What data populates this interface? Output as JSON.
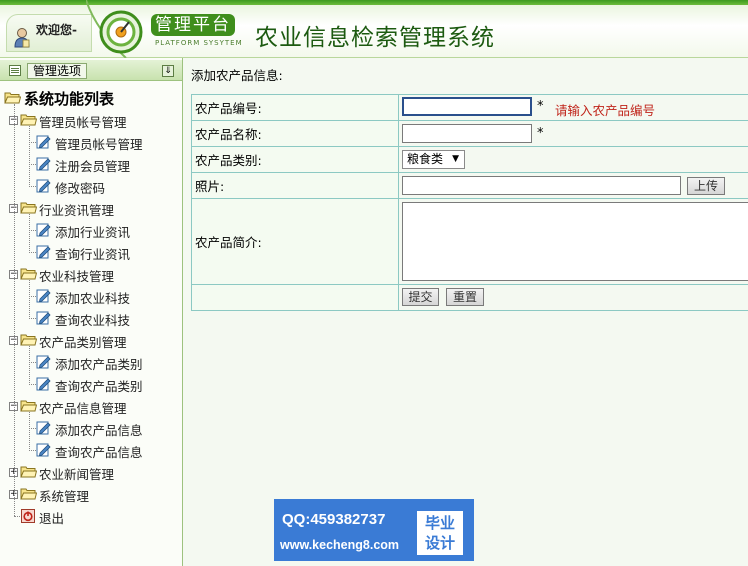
{
  "header": {
    "welcome": "欢迎您-",
    "platform_cn": "管理平台",
    "platform_en": "PLATFORM SYSYTEM",
    "system_title": "农业信息检索管理系统"
  },
  "sidebar": {
    "head_button": "管理选项",
    "root_label": "系统功能列表",
    "groups": [
      {
        "label": "管理员帐号管理",
        "expanded": true,
        "items": [
          "管理员帐号管理",
          "注册会员管理",
          "修改密码"
        ]
      },
      {
        "label": "行业资讯管理",
        "expanded": true,
        "items": [
          "添加行业资讯",
          "查询行业资讯"
        ]
      },
      {
        "label": "农业科技管理",
        "expanded": true,
        "items": [
          "添加农业科技",
          "查询农业科技"
        ]
      },
      {
        "label": "农产品类别管理",
        "expanded": true,
        "items": [
          "添加农产品类别",
          "查询农产品类别"
        ]
      },
      {
        "label": "农产品信息管理",
        "expanded": true,
        "items": [
          "添加农产品信息",
          "查询农产品信息"
        ]
      },
      {
        "label": "农业新闻管理",
        "expanded": false,
        "items": []
      },
      {
        "label": "系统管理",
        "expanded": false,
        "items": []
      }
    ],
    "logout": "退出"
  },
  "form": {
    "caption": "添加农产品信息:",
    "fields": {
      "code_label": "农产品编号:",
      "code_value": "",
      "code_required": "*",
      "code_hint": "请输入农产品编号",
      "name_label": "农产品名称:",
      "name_value": "",
      "name_required": "*",
      "category_label": "农产品类别:",
      "category_selected": "粮食类",
      "photo_label": "照片:",
      "photo_value": "",
      "upload_button": "上传",
      "intro_label": "农产品简介:",
      "intro_value": ""
    },
    "submit_button": "提交",
    "reset_button": "重置"
  },
  "watermark": {
    "qq": "QQ:459382737",
    "url": "www.kecheng8.com",
    "badge_line1": "毕业",
    "badge_line2": "设计"
  },
  "colors": {
    "accent_green": "#3f8e1c",
    "title_green": "#1c5a10",
    "hint_red": "#c0241a",
    "watermark_blue": "#3a7bd5"
  }
}
